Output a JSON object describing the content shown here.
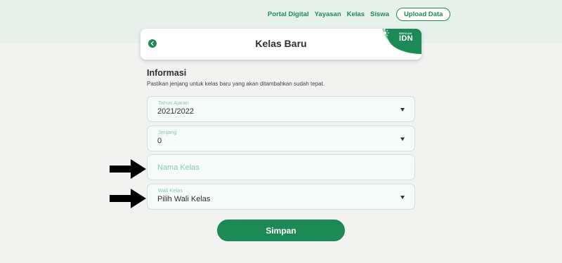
{
  "nav": {
    "links": [
      "Portal Digital",
      "Yayasan",
      "Kelas",
      "Siswa"
    ],
    "upload_label": "Upload Data"
  },
  "header": {
    "title": "Kelas Baru",
    "back_icon": "chevron-left-icon",
    "brand_small": "SEKOLAH",
    "brand_text": "IDN"
  },
  "section": {
    "title": "Informasi",
    "description": "Pastikan jenjang untuk kelas baru yang akan ditambahkan sudah tepat."
  },
  "form": {
    "tahun_ajaran": {
      "label": "Tahun Ajaran",
      "value": "2021/2022"
    },
    "jenjang": {
      "label": "Jenjang",
      "value": "0"
    },
    "nama_kelas": {
      "placeholder": "Nama Kelas",
      "value": ""
    },
    "wali_kelas": {
      "label": "Wali Kelas",
      "value": "Pilih Wali Kelas"
    },
    "submit_label": "Simpan"
  },
  "colors": {
    "accent": "#1d8a56",
    "field_bg": "#f4fbf8",
    "field_border": "#c9e6d8",
    "page_bg": "#f2f3f1",
    "top_band": "#e6f1ec"
  }
}
